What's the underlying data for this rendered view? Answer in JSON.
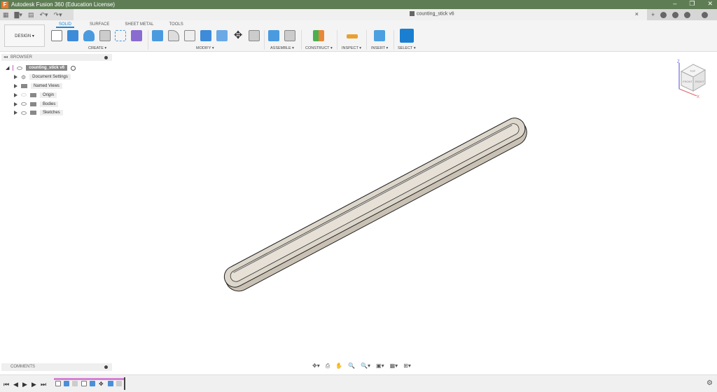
{
  "window": {
    "title": "Autodesk Fusion 360 (Education License)",
    "logo": "F",
    "minimize": "–",
    "restore": "❐",
    "close": "✕"
  },
  "document_tab": {
    "title": "counting_stick v6",
    "close": "×"
  },
  "quick_access": {
    "grid": "▦",
    "file": "▇▾",
    "save": "▤",
    "undo": "↶▾",
    "redo": "↷▾"
  },
  "right_controls": {
    "new_tab": "+"
  },
  "ribbon": {
    "workspace": "DESIGN ▾",
    "tabs": [
      "SOLID",
      "SURFACE",
      "SHEET METAL",
      "TOOLS"
    ],
    "groups": [
      "CREATE ▾",
      "MODIFY ▾",
      "ASSEMBLE ▾",
      "CONSTRUCT ▾",
      "INSPECT ▾",
      "INSERT ▾",
      "SELECT ▾"
    ]
  },
  "browser": {
    "title": "BROWSER",
    "collapse": "◂◂",
    "root": "counting_stick v6",
    "items": [
      "Document Settings",
      "Named Views",
      "Origin",
      "Bodies",
      "Sketches"
    ]
  },
  "comments": {
    "title": "COMMENTS"
  },
  "playback": {
    "first": "⏮",
    "prev": "◀",
    "play": "▶",
    "next": "▶",
    "last": "⏭"
  },
  "nav_bar": [
    "✥▾",
    "⎙",
    "✋",
    "🔍",
    "🔍▾",
    "▣▾",
    "▦▾",
    "⊞▾"
  ],
  "viewcube": {
    "top": "TOP",
    "front": "FRONT",
    "right": "RIGHT",
    "x": "X",
    "z": "Z"
  },
  "settings_icon": "⚙",
  "colors": {
    "titlebar": "#5f7d55",
    "accent": "#1e88d6",
    "timeline": "#d77fd6",
    "body": "#ddd6cb"
  }
}
